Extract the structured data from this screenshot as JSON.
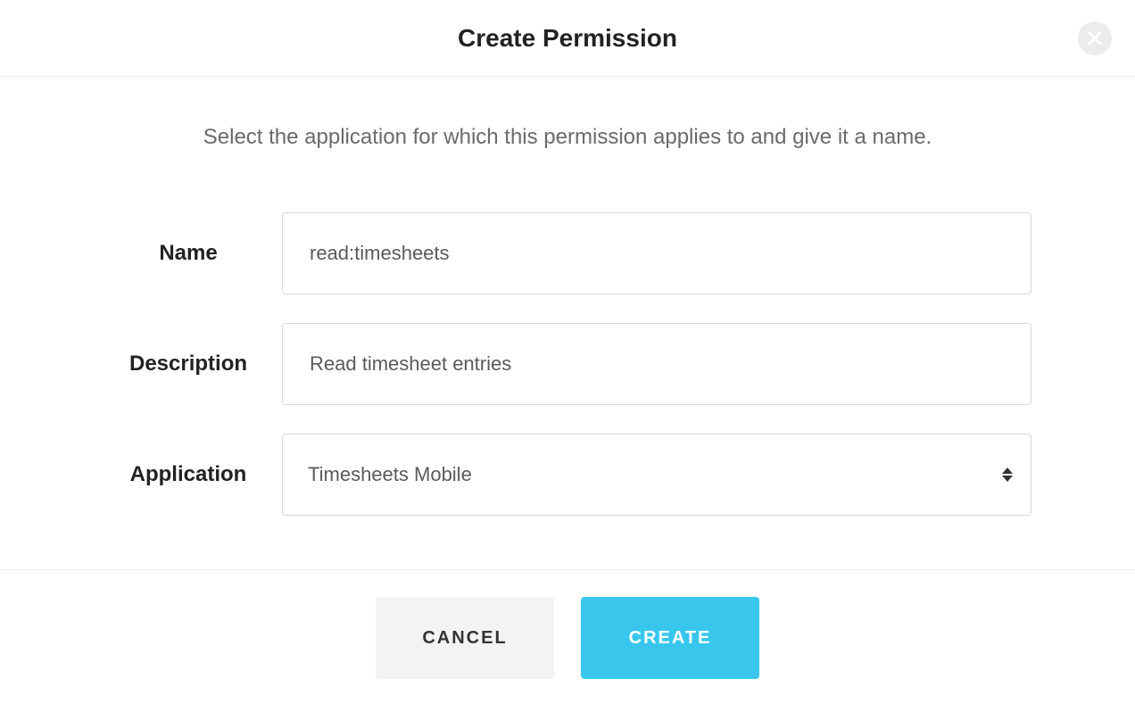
{
  "header": {
    "title": "Create Permission"
  },
  "subtitle": "Select the application for which this permission applies to and give it a name.",
  "form": {
    "name": {
      "label": "Name",
      "value": "read:timesheets"
    },
    "description": {
      "label": "Description",
      "value": "Read timesheet entries"
    },
    "application": {
      "label": "Application",
      "selected": "Timesheets Mobile"
    }
  },
  "footer": {
    "cancel": "CANCEL",
    "create": "CREATE"
  }
}
